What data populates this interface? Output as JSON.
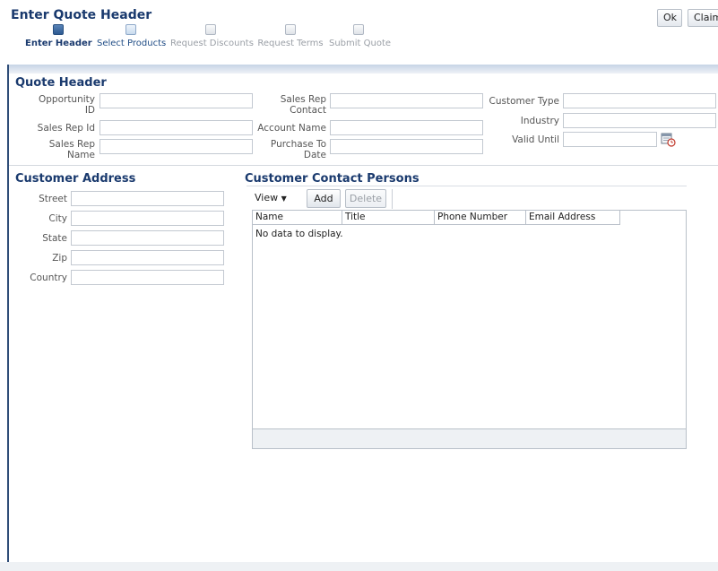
{
  "page": {
    "title": "Enter Quote Header"
  },
  "actions": {
    "ok_label": "Ok",
    "claim_label": "Claim"
  },
  "train": {
    "stops": [
      {
        "label": "Enter Header",
        "state": "current"
      },
      {
        "label": "Select Products",
        "state": "next"
      },
      {
        "label": "Request Discounts",
        "state": "disabled"
      },
      {
        "label": "Request Terms",
        "state": "disabled"
      },
      {
        "label": "Submit Quote",
        "state": "disabled"
      }
    ]
  },
  "quote_header": {
    "title": "Quote Header",
    "opportunity_id": {
      "label_line1": "Opportunity",
      "label_line2": "ID",
      "value": ""
    },
    "sales_rep_id": {
      "label": "Sales Rep Id",
      "value": ""
    },
    "sales_rep_name": {
      "label_line1": "Sales Rep",
      "label_line2": "Name",
      "value": ""
    },
    "sales_rep_contact": {
      "label_line1": "Sales Rep",
      "label_line2": "Contact",
      "value": ""
    },
    "account_name": {
      "label": "Account Name",
      "value": ""
    },
    "purchase_to_date": {
      "label_line1": "Purchase To",
      "label_line2": "Date",
      "value": ""
    },
    "customer_type": {
      "label": "Customer Type",
      "value": ""
    },
    "industry": {
      "label": "Industry",
      "value": ""
    },
    "valid_until": {
      "label": "Valid Until",
      "value": ""
    }
  },
  "customer_address": {
    "title": "Customer Address",
    "street": {
      "label": "Street",
      "value": ""
    },
    "city": {
      "label": "City",
      "value": ""
    },
    "state": {
      "label": "State",
      "value": ""
    },
    "zip": {
      "label": "Zip",
      "value": ""
    },
    "country": {
      "label": "Country",
      "value": ""
    }
  },
  "contacts": {
    "title": "Customer Contact Persons",
    "view_label": "View",
    "add_label": "Add",
    "delete_label": "Delete",
    "columns": [
      "Name",
      "Title",
      "Phone Number",
      "Email Address"
    ],
    "empty_text": "No data to display."
  },
  "colors": {
    "accent": "#1a3a6e",
    "label": "#555555",
    "disabled": "#9a9fa6"
  },
  "icons": {
    "calendar": "calendar-icon",
    "view_dropdown": "chevron-down-icon"
  }
}
